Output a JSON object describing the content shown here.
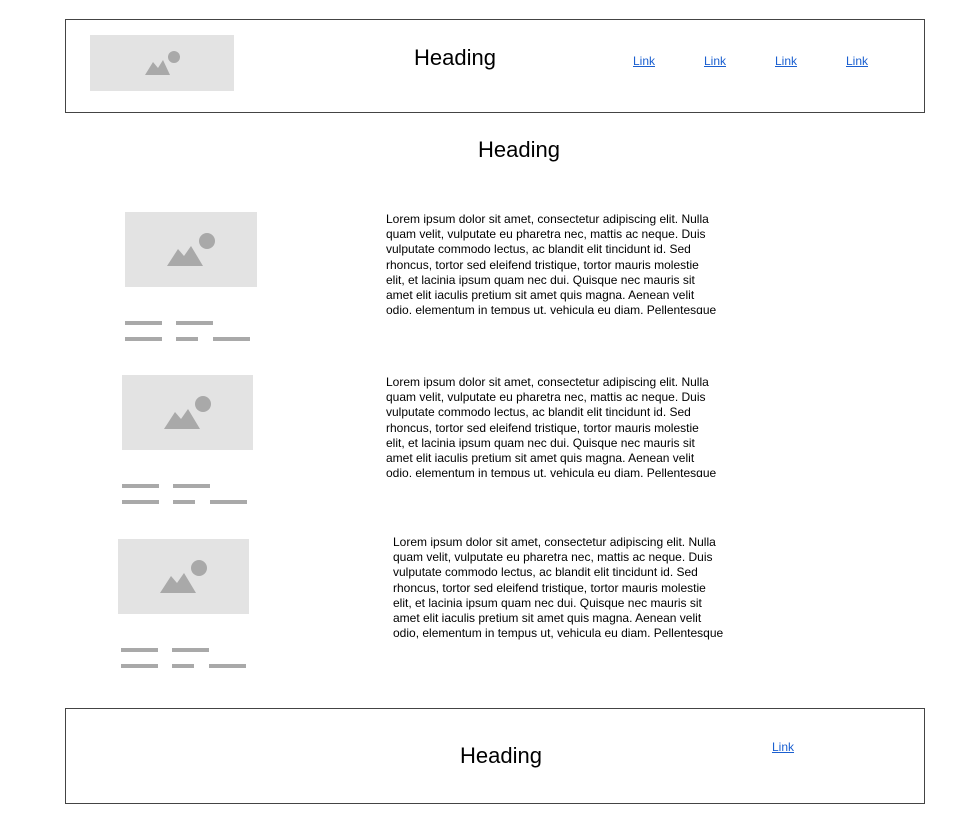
{
  "header": {
    "heading": "Heading",
    "logo_icon": "image-placeholder-icon",
    "nav_links": [
      "Link",
      "Link",
      "Link",
      "Link"
    ]
  },
  "main": {
    "heading": "Heading",
    "sections": [
      {
        "image_icon": "image-placeholder-icon",
        "text": "Lorem ipsum dolor sit amet, consectetur adipiscing elit. Nulla quam velit, vulputate eu pharetra nec, mattis ac neque. Duis vulputate commodo lectus, ac blandit elit tincidunt id. Sed rhoncus, tortor sed eleifend tristique, tortor mauris molestie elit, et lacinia ipsum quam nec dui. Quisque nec mauris sit amet elit iaculis pretium sit amet quis magna. Aenean velit odio, elementum in tempus ut, vehicula eu diam. Pellentesque"
      },
      {
        "image_icon": "image-placeholder-icon",
        "text": "Lorem ipsum dolor sit amet, consectetur adipiscing elit. Nulla quam velit, vulputate eu pharetra nec, mattis ac neque. Duis vulputate commodo lectus, ac blandit elit tincidunt id. Sed rhoncus, tortor sed eleifend tristique, tortor mauris molestie elit, et lacinia ipsum quam nec dui. Quisque nec mauris sit amet elit iaculis pretium sit amet quis magna. Aenean velit odio, elementum in tempus ut, vehicula eu diam. Pellentesque"
      },
      {
        "image_icon": "image-placeholder-icon",
        "text": "Lorem ipsum dolor sit amet, consectetur adipiscing elit. Nulla quam velit, vulputate eu pharetra nec, mattis ac neque. Duis vulputate commodo lectus, ac blandit elit tincidunt id. Sed rhoncus, tortor sed eleifend tristique, tortor mauris molestie elit, et lacinia ipsum quam nec dui. Quisque nec mauris sit amet elit iaculis pretium sit amet quis magna. Aenean velit odio, elementum in tempus ut, vehicula eu diam. Pellentesque"
      }
    ]
  },
  "footer": {
    "heading": "Heading",
    "link": "Link"
  },
  "colors": {
    "placeholder_bg": "#e3e3e3",
    "placeholder_glyph": "#a9a9a9",
    "link": "#1a5fd0",
    "border": "#444444"
  }
}
